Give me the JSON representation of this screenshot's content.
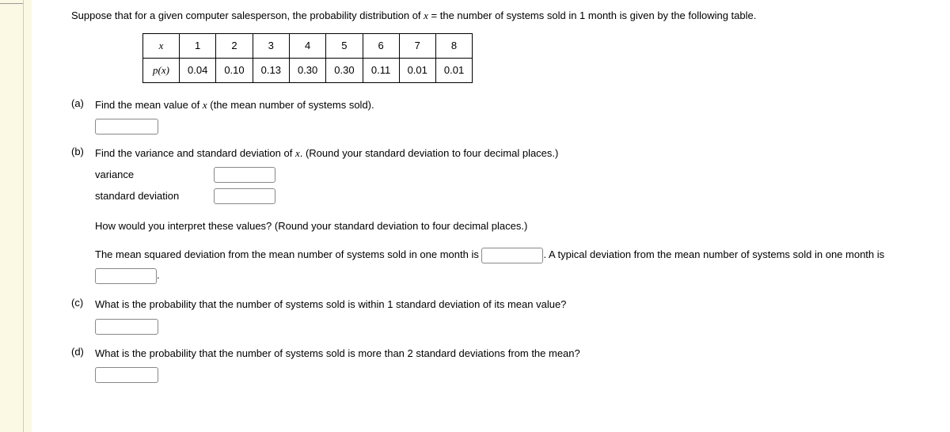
{
  "intro": "Suppose that for a given computer salesperson, the probability distribution of ",
  "intro_var": "x",
  "intro_after": " = the number of systems sold in 1 month is given by the following table.",
  "table": {
    "row1_header": "x",
    "row2_header": "p(x)",
    "x_values": [
      "1",
      "2",
      "3",
      "4",
      "5",
      "6",
      "7",
      "8"
    ],
    "p_values": [
      "0.04",
      "0.10",
      "0.13",
      "0.30",
      "0.30",
      "0.11",
      "0.01",
      "0.01"
    ]
  },
  "part_a": {
    "label": "(a)",
    "text_before": "Find the mean value of ",
    "var": "x",
    "text_after": " (the mean number of systems sold)."
  },
  "part_b": {
    "label": "(b)",
    "text_before": "Find the variance and standard deviation of ",
    "var": "x",
    "text_after": ". (Round your standard deviation to four decimal places.)",
    "variance_label": "variance",
    "sd_label": "standard deviation",
    "interpret_q": "How would you interpret these values? (Round your standard deviation to four decimal places.)",
    "interpret_1": "The mean squared deviation from the mean number of systems sold in one month is ",
    "interpret_2": ". A typical deviation from the mean number of systems sold in one month is ",
    "interpret_3": "."
  },
  "part_c": {
    "label": "(c)",
    "text": "What is the probability that the number of systems sold is within 1 standard deviation of its mean value?"
  },
  "part_d": {
    "label": "(d)",
    "text": "What is the probability that the number of systems sold is more than 2 standard deviations from the mean?"
  }
}
